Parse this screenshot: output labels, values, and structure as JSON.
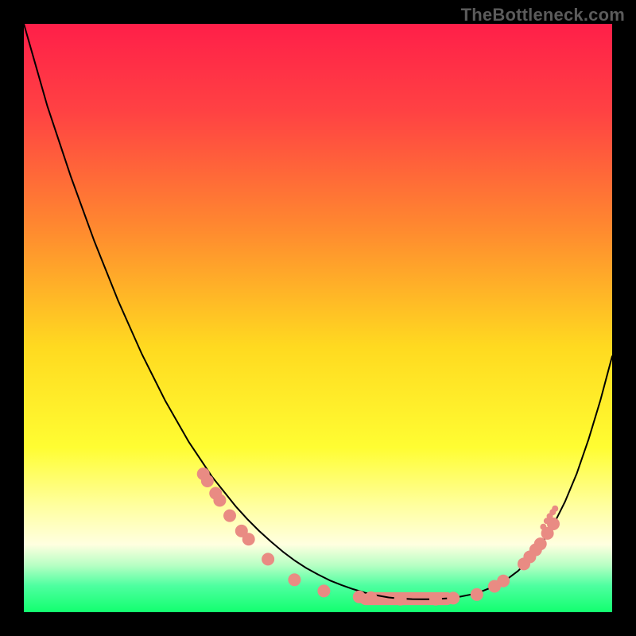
{
  "watermark": "TheBottleneck.com",
  "chart_data": {
    "type": "line",
    "title": "",
    "xlabel": "",
    "ylabel": "",
    "xlim": [
      0,
      100
    ],
    "ylim": [
      0,
      100
    ],
    "grid": false,
    "legend": false,
    "background_gradient_stops": [
      {
        "offset": 0.0,
        "color": "#ff1f49"
      },
      {
        "offset": 0.15,
        "color": "#ff4243"
      },
      {
        "offset": 0.35,
        "color": "#ff8a2f"
      },
      {
        "offset": 0.55,
        "color": "#ffda20"
      },
      {
        "offset": 0.72,
        "color": "#fffd32"
      },
      {
        "offset": 0.82,
        "color": "#ffffa0"
      },
      {
        "offset": 0.885,
        "color": "#ffffe0"
      },
      {
        "offset": 0.92,
        "color": "#b8ffc4"
      },
      {
        "offset": 0.955,
        "color": "#4effa0"
      },
      {
        "offset": 1.0,
        "color": "#12ff6f"
      }
    ],
    "series": [
      {
        "name": "curve",
        "color": "#000000",
        "stroke_width": 2,
        "x": [
          0,
          2,
          4,
          6,
          8,
          10,
          12,
          14,
          16,
          18,
          20,
          22,
          24,
          26,
          28,
          30,
          32,
          34,
          36,
          38,
          40,
          42,
          44,
          46,
          48,
          50,
          52,
          54,
          56,
          58,
          60,
          62,
          64,
          66,
          68,
          70,
          72,
          74,
          76,
          78,
          80,
          82,
          84,
          86,
          88,
          90,
          92,
          94,
          96,
          98,
          100
        ],
        "y": [
          100,
          93,
          86,
          80,
          74,
          68.5,
          63,
          58,
          53,
          48.5,
          44,
          40,
          36,
          32.5,
          29,
          26,
          23,
          20.5,
          18,
          15.8,
          13.8,
          12,
          10.3,
          8.8,
          7.5,
          6.4,
          5.4,
          4.6,
          3.9,
          3.3,
          2.85,
          2.5,
          2.3,
          2.22,
          2.2,
          2.22,
          2.34,
          2.6,
          3.0,
          3.6,
          4.4,
          5.5,
          7.0,
          9.0,
          11.6,
          14.8,
          18.8,
          23.6,
          29.4,
          36.0,
          43.5
        ]
      }
    ],
    "points": {
      "name": "markers",
      "color": "#e98b83",
      "radius": 8,
      "data": [
        {
          "x": 30.5,
          "y": 23.5
        },
        {
          "x": 31.2,
          "y": 22.3
        },
        {
          "x": 32.6,
          "y": 20.2
        },
        {
          "x": 33.3,
          "y": 19.0
        },
        {
          "x": 35.0,
          "y": 16.4
        },
        {
          "x": 37.0,
          "y": 13.8
        },
        {
          "x": 38.2,
          "y": 12.4
        },
        {
          "x": 41.5,
          "y": 9.0
        },
        {
          "x": 46.0,
          "y": 5.5
        },
        {
          "x": 51.0,
          "y": 3.6
        },
        {
          "x": 57.0,
          "y": 2.6
        },
        {
          "x": 59.0,
          "y": 2.45
        },
        {
          "x": 64.0,
          "y": 2.22
        },
        {
          "x": 70.0,
          "y": 2.22
        },
        {
          "x": 73.0,
          "y": 2.38
        },
        {
          "x": 77.0,
          "y": 3.0
        },
        {
          "x": 80.0,
          "y": 4.4
        },
        {
          "x": 81.5,
          "y": 5.3
        },
        {
          "x": 85.0,
          "y": 8.2
        },
        {
          "x": 86.0,
          "y": 9.4
        },
        {
          "x": 87.0,
          "y": 10.6
        },
        {
          "x": 87.8,
          "y": 11.6
        },
        {
          "x": 89.0,
          "y": 13.4
        },
        {
          "x": 90.0,
          "y": 15.0
        }
      ]
    },
    "flat_band": {
      "x_start": 57.0,
      "x_end": 73.0,
      "y": 2.3,
      "height": 2.2,
      "color": "#e98b83"
    },
    "extra_markers": {
      "color": "#e98b83",
      "radius": 4,
      "data": [
        {
          "x": 88.3,
          "y": 14.5
        },
        {
          "x": 88.9,
          "y": 15.5
        },
        {
          "x": 89.4,
          "y": 16.3
        },
        {
          "x": 89.9,
          "y": 17.0
        },
        {
          "x": 90.3,
          "y": 17.6
        }
      ]
    }
  }
}
